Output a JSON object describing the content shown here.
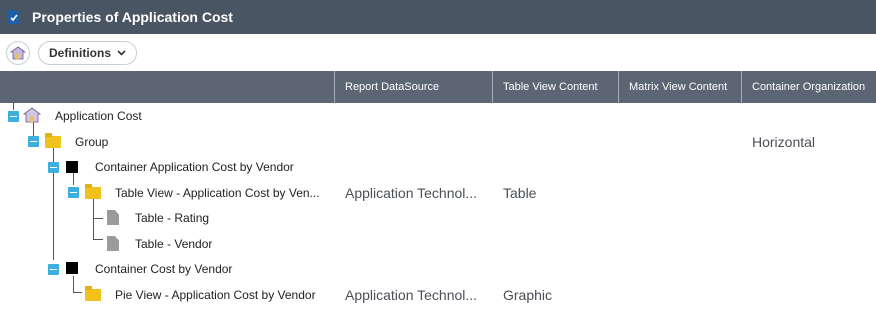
{
  "window": {
    "title": "Properties of Application Cost",
    "title_icon": "document-check-icon"
  },
  "toolbar": {
    "home_icon": "report-house-icon",
    "definitions_label": "Definitions",
    "definitions_icon": "chevron-down-icon"
  },
  "columns": [
    {
      "label": ""
    },
    {
      "label": "Report DataSource"
    },
    {
      "label": "Table View Content"
    },
    {
      "label": "Matrix View Content"
    },
    {
      "label": "Container Organization"
    }
  ],
  "tree": {
    "root": {
      "label": "Application Cost",
      "icon": "report-house-icon"
    },
    "group": {
      "label": "Group",
      "icon": "folder-icon",
      "container_org": "Horizontal"
    },
    "container1": {
      "label": "Container Application Cost by Vendor",
      "icon": "black-square-icon"
    },
    "table_view": {
      "label": "Table View - Application Cost by Ven...",
      "icon": "folder-icon",
      "datasource": "Application Technol...",
      "table_content": "Table"
    },
    "table_rating": {
      "label": "Table - Rating",
      "icon": "document-icon"
    },
    "table_vendor": {
      "label": "Table - Vendor",
      "icon": "document-icon"
    },
    "container2": {
      "label": "Container Cost by Vendor",
      "icon": "black-square-icon"
    },
    "pie_view": {
      "label": "Pie View - Application Cost by Vendor",
      "icon": "folder-icon",
      "datasource": "Application Technol...",
      "table_content": "Graphic"
    }
  },
  "colors": {
    "title_bar": "#4a5563",
    "header_row": "#5b6573",
    "toggle": "#3bb0df",
    "folder": "#f1c21b"
  }
}
